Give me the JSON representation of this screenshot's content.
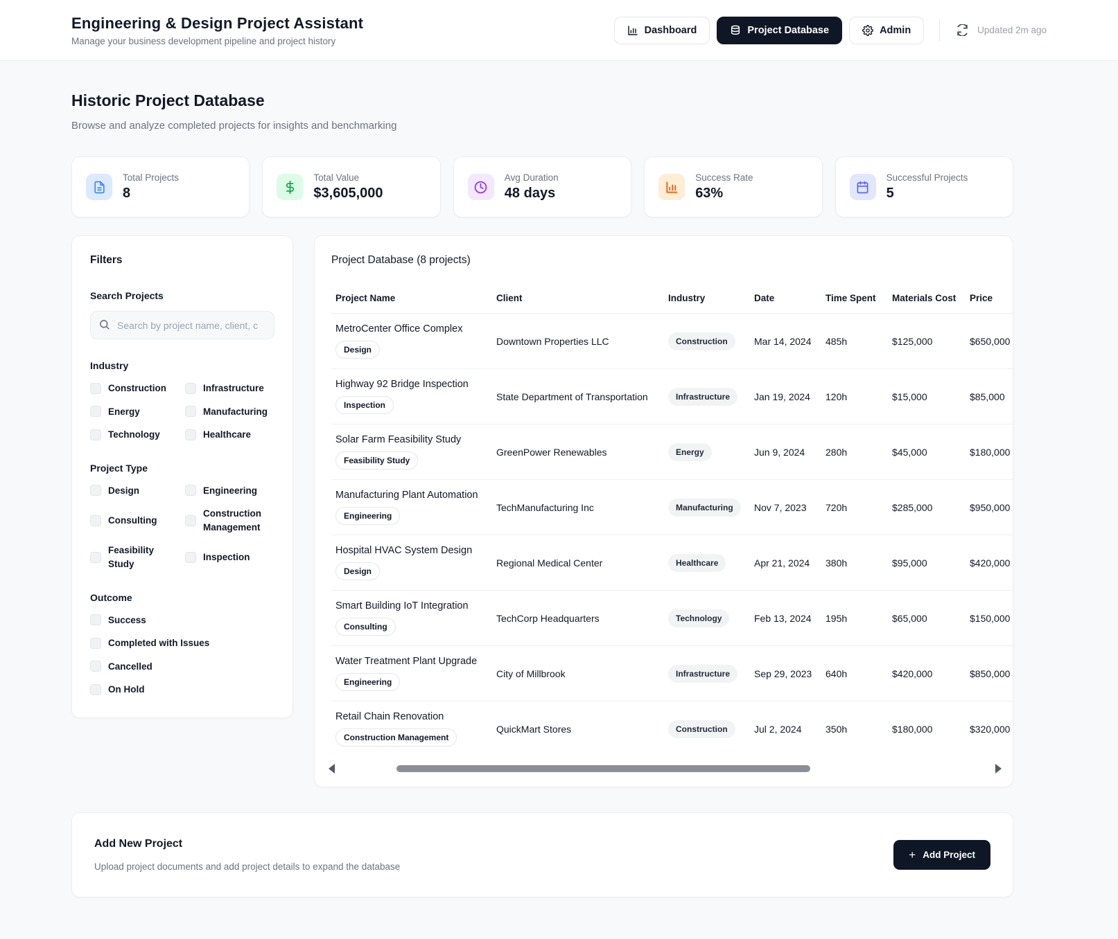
{
  "header": {
    "title": "Engineering & Design Project Assistant",
    "subtitle": "Manage your business development pipeline and project history",
    "nav": [
      {
        "label": "Dashboard",
        "icon": "bar-chart-icon",
        "active": false
      },
      {
        "label": "Project Database",
        "icon": "database-icon",
        "active": true
      },
      {
        "label": "Admin",
        "icon": "gear-icon",
        "active": false
      }
    ],
    "updated": "Updated 2m ago"
  },
  "page": {
    "title": "Historic Project Database",
    "subtitle": "Browse and analyze completed projects for insights and benchmarking"
  },
  "stats": [
    {
      "label": "Total Projects",
      "value": "8",
      "icon": "file-icon",
      "fg": "#3b82f6",
      "bg": "#dbeafe"
    },
    {
      "label": "Total Value",
      "value": "$3,605,000",
      "icon": "dollar-icon",
      "fg": "#16a34a",
      "bg": "#dcfce7"
    },
    {
      "label": "Avg Duration",
      "value": "48 days",
      "icon": "clock-icon",
      "fg": "#9333ea",
      "bg": "#f3e8ff"
    },
    {
      "label": "Success Rate",
      "value": "63%",
      "icon": "bar-chart-icon",
      "fg": "#ea580c",
      "bg": "#ffedd5"
    },
    {
      "label": "Successful Projects",
      "value": "5",
      "icon": "calendar-icon",
      "fg": "#6366f1",
      "bg": "#e0e7ff"
    }
  ],
  "filters": {
    "heading": "Filters",
    "search_label": "Search Projects",
    "search_placeholder": "Search by project name, client, c",
    "industry": {
      "title": "Industry",
      "options": [
        "Construction",
        "Infrastructure",
        "Energy",
        "Manufacturing",
        "Technology",
        "Healthcare"
      ]
    },
    "project_type": {
      "title": "Project Type",
      "options": [
        "Design",
        "Engineering",
        "Consulting",
        "Construction Management",
        "Feasibility Study",
        "Inspection"
      ]
    },
    "outcome": {
      "title": "Outcome",
      "options": [
        "Success",
        "Completed with Issues",
        "Cancelled",
        "On Hold"
      ]
    }
  },
  "table": {
    "title": "Project Database (8 projects)",
    "columns": [
      "Project Name",
      "Client",
      "Industry",
      "Date",
      "Time Spent",
      "Materials Cost",
      "Price"
    ],
    "rows": [
      {
        "name": "MetroCenter Office Complex",
        "type": "Design",
        "client": "Downtown Properties LLC",
        "industry": "Construction",
        "date": "Mar 14, 2024",
        "time": "485h",
        "materials": "$125,000",
        "price": "$650,000"
      },
      {
        "name": "Highway 92 Bridge Inspection",
        "type": "Inspection",
        "client": "State Department of Transportation",
        "industry": "Infrastructure",
        "date": "Jan 19, 2024",
        "time": "120h",
        "materials": "$15,000",
        "price": "$85,000"
      },
      {
        "name": "Solar Farm Feasibility Study",
        "type": "Feasibility Study",
        "client": "GreenPower Renewables",
        "industry": "Energy",
        "date": "Jun 9, 2024",
        "time": "280h",
        "materials": "$45,000",
        "price": "$180,000"
      },
      {
        "name": "Manufacturing Plant Automation",
        "type": "Engineering",
        "client": "TechManufacturing Inc",
        "industry": "Manufacturing",
        "date": "Nov 7, 2023",
        "time": "720h",
        "materials": "$285,000",
        "price": "$950,000"
      },
      {
        "name": "Hospital HVAC System Design",
        "type": "Design",
        "client": "Regional Medical Center",
        "industry": "Healthcare",
        "date": "Apr 21, 2024",
        "time": "380h",
        "materials": "$95,000",
        "price": "$420,000"
      },
      {
        "name": "Smart Building IoT Integration",
        "type": "Consulting",
        "client": "TechCorp Headquarters",
        "industry": "Technology",
        "date": "Feb 13, 2024",
        "time": "195h",
        "materials": "$65,000",
        "price": "$150,000"
      },
      {
        "name": "Water Treatment Plant Upgrade",
        "type": "Engineering",
        "client": "City of Millbrook",
        "industry": "Infrastructure",
        "date": "Sep 29, 2023",
        "time": "640h",
        "materials": "$420,000",
        "price": "$850,000"
      },
      {
        "name": "Retail Chain Renovation",
        "type": "Construction Management",
        "client": "QuickMart Stores",
        "industry": "Construction",
        "date": "Jul 2, 2024",
        "time": "350h",
        "materials": "$180,000",
        "price": "$320,000"
      }
    ]
  },
  "add_section": {
    "title": "Add New Project",
    "subtitle": "Upload project documents and add project details to expand the database",
    "button": "Add Project"
  },
  "colors": {
    "accent_dark": "#0f1625",
    "page_bg": "#f8f9fb",
    "muted_text": "#6b7280"
  }
}
